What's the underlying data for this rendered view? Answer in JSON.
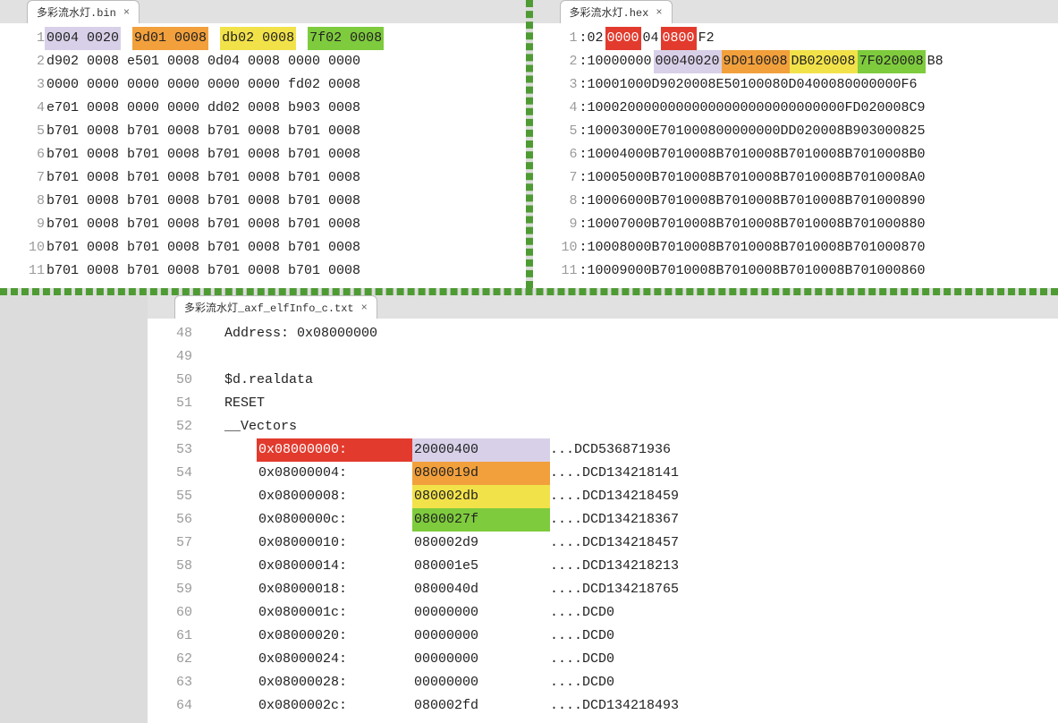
{
  "top_left": {
    "tab_label": "多彩流水灯.bin",
    "rows": [
      {
        "n": "1",
        "cells": [
          {
            "t": "0004 0020",
            "cls": "hl-lav"
          },
          {
            "t": " "
          },
          {
            "t": "9d01 0008",
            "cls": "hl-org"
          },
          {
            "t": " "
          },
          {
            "t": "db02 0008",
            "cls": "hl-yel"
          },
          {
            "t": " "
          },
          {
            "t": "7f02 0008",
            "cls": "hl-grn"
          }
        ]
      },
      {
        "n": "2",
        "cells": [
          {
            "t": "d902 0008 e501 0008 0d04 0008 0000 0000"
          }
        ]
      },
      {
        "n": "3",
        "cells": [
          {
            "t": "0000 0000 0000 0000 0000 0000 fd02 0008"
          }
        ]
      },
      {
        "n": "4",
        "cells": [
          {
            "t": "e701 0008 0000 0000 dd02 0008 b903 0008"
          }
        ]
      },
      {
        "n": "5",
        "cells": [
          {
            "t": "b701 0008 b701 0008 b701 0008 b701 0008"
          }
        ]
      },
      {
        "n": "6",
        "cells": [
          {
            "t": "b701 0008 b701 0008 b701 0008 b701 0008"
          }
        ]
      },
      {
        "n": "7",
        "cells": [
          {
            "t": "b701 0008 b701 0008 b701 0008 b701 0008"
          }
        ]
      },
      {
        "n": "8",
        "cells": [
          {
            "t": "b701 0008 b701 0008 b701 0008 b701 0008"
          }
        ]
      },
      {
        "n": "9",
        "cells": [
          {
            "t": "b701 0008 b701 0008 b701 0008 b701 0008"
          }
        ]
      },
      {
        "n": "10",
        "cells": [
          {
            "t": "b701 0008 b701 0008 b701 0008 b701 0008"
          }
        ]
      },
      {
        "n": "11",
        "cells": [
          {
            "t": "b701 0008 b701 0008 b701 0008 b701 0008"
          }
        ]
      }
    ]
  },
  "top_right": {
    "tab_label": "多彩流水灯.hex",
    "rows": [
      {
        "n": "1",
        "cells": [
          {
            "t": ":02"
          },
          {
            "t": "0000",
            "cls": "hl-red"
          },
          {
            "t": "04"
          },
          {
            "t": "0800",
            "cls": "hl-red"
          },
          {
            "t": "F2"
          }
        ]
      },
      {
        "n": "2",
        "cells": [
          {
            "t": ":10000000"
          },
          {
            "t": "00040020",
            "cls": "hl-lav"
          },
          {
            "t": "9D010008",
            "cls": "hl-org"
          },
          {
            "t": "DB020008",
            "cls": "hl-yel"
          },
          {
            "t": "7F020008",
            "cls": "hl-grn"
          },
          {
            "t": "B8"
          }
        ]
      },
      {
        "n": "3",
        "cells": [
          {
            "t": ":10001000D9020008E50100080D0400080000000F6"
          }
        ]
      },
      {
        "n": "4",
        "cells": [
          {
            "t": ":10002000000000000000000000000000FD020008C9"
          }
        ]
      },
      {
        "n": "5",
        "cells": [
          {
            "t": ":10003000E701000800000000DD020008B903000825"
          }
        ]
      },
      {
        "n": "6",
        "cells": [
          {
            "t": ":10004000B7010008B7010008B7010008B7010008B0"
          }
        ]
      },
      {
        "n": "7",
        "cells": [
          {
            "t": ":10005000B7010008B7010008B7010008B7010008A0"
          }
        ]
      },
      {
        "n": "8",
        "cells": [
          {
            "t": ":10006000B7010008B7010008B7010008B701000890"
          }
        ]
      },
      {
        "n": "9",
        "cells": [
          {
            "t": ":10007000B7010008B7010008B7010008B701000880"
          }
        ]
      },
      {
        "n": "10",
        "cells": [
          {
            "t": ":10008000B7010008B7010008B7010008B701000870"
          }
        ]
      },
      {
        "n": "11",
        "cells": [
          {
            "t": ":10009000B7010008B7010008B7010008B701000860"
          }
        ]
      }
    ]
  },
  "bottom": {
    "tab_label": "多彩流水灯_axf_elfInfo_c.txt",
    "rows": [
      {
        "n": "48",
        "plain": "    Address: 0x08000000"
      },
      {
        "n": "49",
        "plain": ""
      },
      {
        "n": "50",
        "plain": "    $d.realdata"
      },
      {
        "n": "51",
        "plain": "    RESET"
      },
      {
        "n": "52",
        "plain": "    __Vectors"
      },
      {
        "n": "53",
        "cols": {
          "addr": "0x08000000:",
          "addr_cls": "hl-red",
          "val": "20000400",
          "val_cls": "hl-lav",
          "dots": "...",
          "dcd": "DCD",
          "dec": "536871936"
        }
      },
      {
        "n": "54",
        "cols": {
          "addr": "0x08000004:",
          "val": "0800019d",
          "val_cls": "hl-org",
          "dots": "....",
          "dcd": "DCD",
          "dec": "134218141"
        }
      },
      {
        "n": "55",
        "cols": {
          "addr": "0x08000008:",
          "val": "080002db",
          "val_cls": "hl-yel",
          "dots": "....",
          "dcd": "DCD",
          "dec": "134218459"
        }
      },
      {
        "n": "56",
        "cols": {
          "addr": "0x0800000c:",
          "val": "0800027f",
          "val_cls": "hl-grn",
          "dots": "....",
          "dcd": "DCD",
          "dec": "134218367"
        }
      },
      {
        "n": "57",
        "cols": {
          "addr": "0x08000010:",
          "val": "080002d9",
          "dots": "....",
          "dcd": "DCD",
          "dec": "134218457"
        }
      },
      {
        "n": "58",
        "cols": {
          "addr": "0x08000014:",
          "val": "080001e5",
          "dots": "....",
          "dcd": "DCD",
          "dec": "134218213"
        }
      },
      {
        "n": "59",
        "cols": {
          "addr": "0x08000018:",
          "val": "0800040d",
          "dots": "....",
          "dcd": "DCD",
          "dec": "134218765"
        }
      },
      {
        "n": "60",
        "cols": {
          "addr": "0x0800001c:",
          "val": "00000000",
          "dots": "....",
          "dcd": "DCD",
          "dec": "0"
        }
      },
      {
        "n": "61",
        "cols": {
          "addr": "0x08000020:",
          "val": "00000000",
          "dots": "....",
          "dcd": "DCD",
          "dec": "0"
        }
      },
      {
        "n": "62",
        "cols": {
          "addr": "0x08000024:",
          "val": "00000000",
          "dots": "....",
          "dcd": "DCD",
          "dec": "0"
        }
      },
      {
        "n": "63",
        "cols": {
          "addr": "0x08000028:",
          "val": "00000000",
          "dots": "....",
          "dcd": "DCD",
          "dec": "0"
        }
      },
      {
        "n": "64",
        "cols": {
          "addr": "0x0800002c:",
          "val": "080002fd",
          "dots": "....",
          "dcd": "DCD",
          "dec": "134218493"
        }
      }
    ]
  }
}
